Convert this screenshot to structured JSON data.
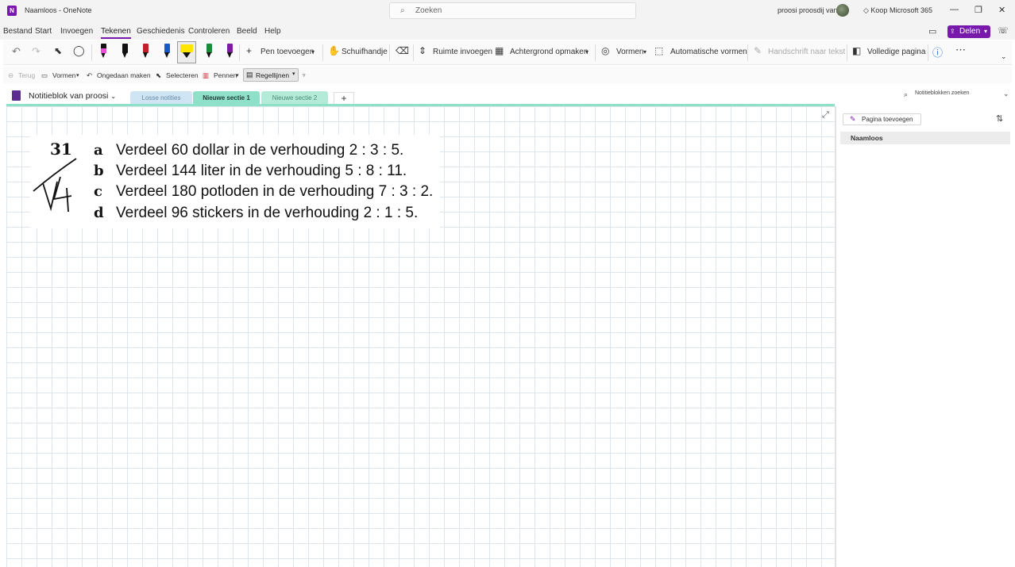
{
  "titlebar": {
    "app_title": "Naamloos  -  OneNote",
    "search_placeholder": "Zoeken",
    "user_name": "proosi proosdij van",
    "buy_label": "Koop Microsoft 365"
  },
  "menubar": {
    "items": [
      "Bestand",
      "Start",
      "Invoegen",
      "Tekenen",
      "Geschiedenis",
      "Controleren",
      "Beeld",
      "Help"
    ],
    "active": "Tekenen",
    "share_label": "Delen"
  },
  "ribbon": {
    "add_pen": "Pen toevoegen",
    "hand": "Schuifhandje",
    "insert_space": "Ruimte invoegen",
    "background": "Achtergrond opmaken",
    "shapes": "Vormen",
    "auto_shapes": "Automatische vormen",
    "ink_to_text": "Handschrift naar tekst",
    "full_page": "Volledige pagina",
    "pens": [
      {
        "color": "#e94fd8",
        "band": "#111"
      },
      {
        "color": "#111111",
        "band": "#111"
      },
      {
        "color": "#c21f28",
        "band": "#c21f28"
      },
      {
        "color": "#1d58c9",
        "band": "#1d58c9"
      },
      {
        "color": "#ffe600",
        "band": "#ffe600"
      },
      {
        "color": "#1e8a3a",
        "band": "#1e8a3a"
      },
      {
        "color": "#7a1f9f",
        "band": "#7a1f9f"
      }
    ]
  },
  "subbar": {
    "back": "Terug",
    "shapes": "Vormen",
    "undo": "Ongedaan maken",
    "select": "Selecteren",
    "pens": "Pennen",
    "rule_lines": "Regellijnen"
  },
  "notebook": {
    "name": "Notitieblok van proosi",
    "tabs": [
      {
        "label": "Losse notities",
        "bg": "#cfe5f4",
        "color": "#6a8aa2",
        "bold": false
      },
      {
        "label": "Nieuwe sectie 1",
        "bg": "#8ee0c9",
        "color": "#1f3d36",
        "bold": true
      },
      {
        "label": "Nieuwe sectie 2",
        "bg": "#b4ead8",
        "color": "#4a8a78",
        "bold": false
      }
    ],
    "add_tab": "+",
    "search_placeholder": "Notitieblokken zoeken"
  },
  "page": {
    "problem_number": "31",
    "exercises": [
      {
        "letter": "a",
        "text": "Verdeel 60 dollar in de verhouding 2 : 3 : 5."
      },
      {
        "letter": "b",
        "text": "Verdeel 144 liter in de verhouding 5 : 8 : 11."
      },
      {
        "letter": "c",
        "text": "Verdeel 180 potloden in de verhouding 7 : 3 : 2."
      },
      {
        "letter": "d",
        "text": "Verdeel 96 stickers in de verhouding 2 : 1 : 5."
      }
    ]
  },
  "rightpanel": {
    "add_page": "Pagina toevoegen",
    "pages": [
      "Naamloos"
    ]
  }
}
